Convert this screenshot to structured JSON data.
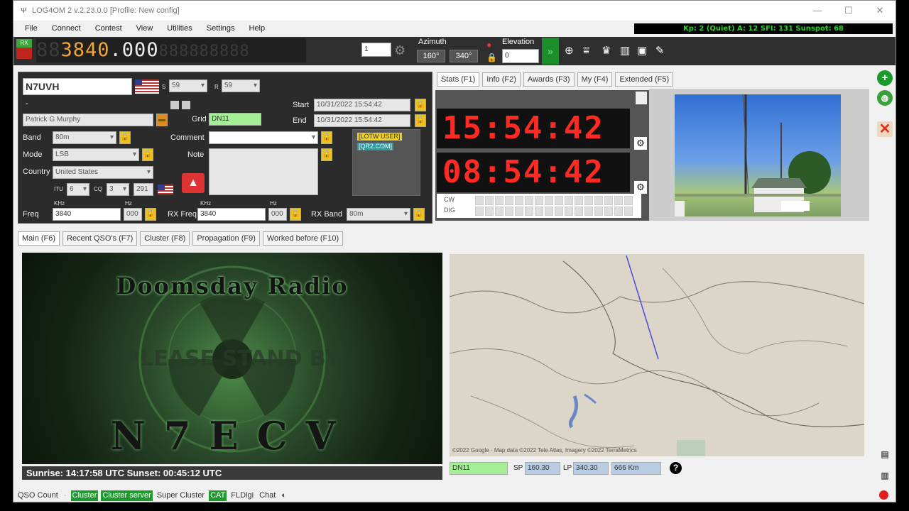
{
  "title": "LOG4OM 2 v.2.23.0.0 [Profile: New config]",
  "window_controls": [
    "—",
    "☐",
    "✕"
  ],
  "menu": [
    "File",
    "Connect",
    "Contest",
    "View",
    "Utilities",
    "Settings",
    "Help"
  ],
  "solar": "Kp: 2 (Quiet)  A: 12  SFI: 131  Sunspot: 68",
  "toolbar": {
    "rx_label": "RX",
    "freq_main": "3840",
    "freq_frac": ".000",
    "freq_sub": "888888888",
    "spin_value": "1",
    "azimuth_label": "Azimuth",
    "az_sp": "160°",
    "az_lp": "340°",
    "elevation_label": "Elevation",
    "elevation_value": "0"
  },
  "qso": {
    "callsign": "N7UVH",
    "s_label": "S",
    "s_value": "59",
    "r_label": "R",
    "r_value": "59",
    "dash": "-",
    "name": "Patrick G Murphy",
    "grid_label": "Grid",
    "grid": "DN11",
    "start_label": "Start",
    "start": "10/31/2022 15:54:42",
    "end_label": "End",
    "end": "10/31/2022 15:54:42",
    "band_label": "Band",
    "band": "80m",
    "comment_label": "Comment",
    "comment": "",
    "mode_label": "Mode",
    "mode": "LSB",
    "note_label": "Note",
    "note": "",
    "country_label": "Country",
    "country": "United States",
    "itu_label": "ITU",
    "itu": "6",
    "cq_label": "CQ",
    "cq": "3",
    "dxcc": "291",
    "lotw_tag": "[LOTW USER]",
    "qrz_tag": "[QR2.COM]",
    "khz_label": "KHz",
    "hz_label": "Hz",
    "freq_label": "Freq",
    "freq_khz": "3840",
    "freq_hz": "000",
    "rx_freq_label": "RX Freq",
    "rx_freq_khz": "3840",
    "rx_freq_hz": "000",
    "rx_band_label": "RX Band",
    "rx_band": "80m"
  },
  "info_tabs": [
    "Stats (F1)",
    "Info (F2)",
    "Awards (F3)",
    "My (F4)",
    "Extended (F5)"
  ],
  "clock": {
    "utc": "15:54:42 utc",
    "local": "08:54:42 Loc",
    "cw_label": "CW",
    "dig_label": "DIG"
  },
  "main_tabs": [
    "Main (F6)",
    "Recent QSO's (F7)",
    "Cluster (F8)",
    "Propagation (F9)",
    "Worked before (F10)"
  ],
  "logo": {
    "title": "Doomsday Radio",
    "subtitle": "PLEASE STAND BY",
    "callsign": "N7ECV"
  },
  "sun": "Sunrise: 14:17:58 UTC  Sunset: 00:45:12 UTC",
  "map": {
    "attribution": "©2022 Google · Map data ©2022 Tele Atlas, Imagery ©2022 TerraMetrics",
    "grid": "DN11",
    "sp_label": "SP",
    "sp": "160.30",
    "lp_label": "LP",
    "lp": "340.30",
    "distance": "666 Km",
    "help": "?"
  },
  "status": [
    "QSO Count",
    "Cluster",
    "Cluster server",
    "Super Cluster",
    "CAT",
    "FLDigi",
    "Chat"
  ],
  "colors": {
    "accent_green": "#1e9a2e",
    "freq_orange": "#f2a53a",
    "clock_red": "#ff2a22"
  }
}
